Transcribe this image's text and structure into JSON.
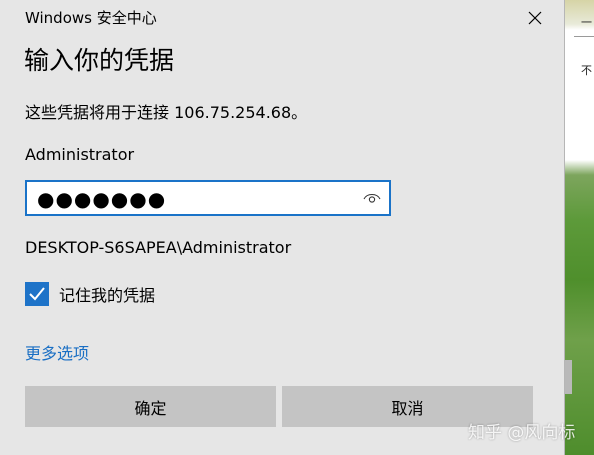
{
  "window": {
    "title": "Windows 安全中心",
    "close_icon": "close-icon"
  },
  "dialog": {
    "heading": "输入你的凭据",
    "description": "这些凭据将用于连接 106.75.254.68。",
    "username": "Administrator",
    "password_masked": "●●●●●●●",
    "reveal_icon": "eye-icon",
    "account": "DESKTOP-S6SAPEA\\Administrator",
    "remember_label": "记住我的凭据",
    "remember_checked": true,
    "more_options": "更多选项",
    "ok_label": "确定",
    "cancel_label": "取消"
  },
  "background": {
    "fragment_a": "一",
    "fragment_b": "不"
  },
  "watermark": "知乎 @风向标",
  "colors": {
    "dialog_bg": "#e6e6e6",
    "accent": "#1e73c8",
    "link": "#1a6fc4",
    "button_bg": "#c4c4c4"
  }
}
